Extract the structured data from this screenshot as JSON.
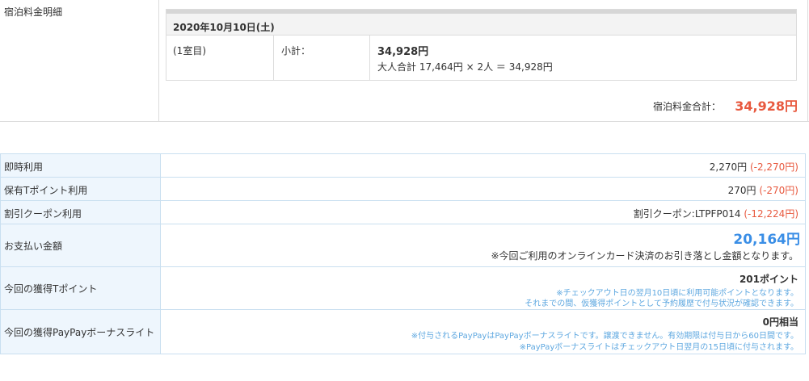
{
  "room_charges": {
    "label": "宿泊料金明細",
    "date": "2020年10月10日(土)",
    "room": "(1室目)",
    "subtotal_label": "小計：",
    "subtotal_amount": "34,928円",
    "calc": "大人合計 17,464円 × 2人 ＝ 34,928円",
    "total_label": "宿泊料金合計：",
    "total_amount": "34,928円"
  },
  "payment": {
    "instant": {
      "label": "即時利用",
      "amount": "2,270円",
      "deduction": "(-2,270円)"
    },
    "tpoint": {
      "label": "保有Tポイント利用",
      "amount": "270円",
      "deduction": "(-270円)"
    },
    "coupon": {
      "label": "割引クーポン利用",
      "amount": "割引クーポン:LTPFP014",
      "deduction": "(-12,224円)"
    },
    "pay_amount": {
      "label": "お支払い金額",
      "amount": "20,164円",
      "note": "※今回ご利用のオンラインカード決済のお引き落とし金額となります。"
    },
    "earn_tpoint": {
      "label": "今回の獲得Tポイント",
      "value": "201ポイント",
      "note1": "※チェックアウト日の翌月10日頃に利用可能ポイントとなります。",
      "note2": "それまでの間、仮獲得ポイントとして予約履歴で付与状況が確認できます。"
    },
    "earn_paypay": {
      "label": "今回の獲得PayPayボーナスライト",
      "value": "0円相当",
      "note1": "※付与されるPayPayはPayPayボーナスライトです。譲渡できません。有効期限は付与日から60日間です。",
      "note2": "※PayPayボーナスライトはチェックアウト日翌月の15日頃に付与されます。"
    }
  },
  "colors": {
    "negative": "#e8593f",
    "highlight_blue": "#3a8ee6",
    "label_bg": "#eef6fd"
  }
}
